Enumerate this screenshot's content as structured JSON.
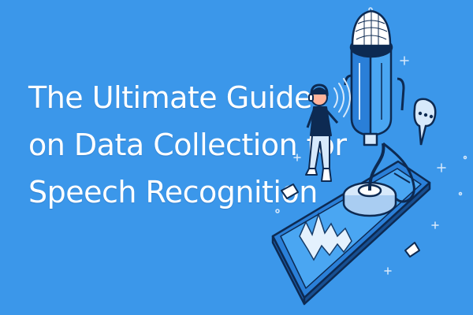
{
  "banner": {
    "title_lines": [
      "The Ultimate Guide",
      "on Data Collection for",
      "Speech Recognition"
    ],
    "background_color": "#3b97ea",
    "text_color": "#ffffff"
  },
  "illustration": {
    "items": [
      "microphone-icon",
      "smartphone-icon",
      "person-with-headphones-icon",
      "sound-wave-icon",
      "speech-bubble-icon",
      "sparkle-icon"
    ],
    "line_color": "#0d2a52",
    "accent_color": "#d7e9fb"
  }
}
